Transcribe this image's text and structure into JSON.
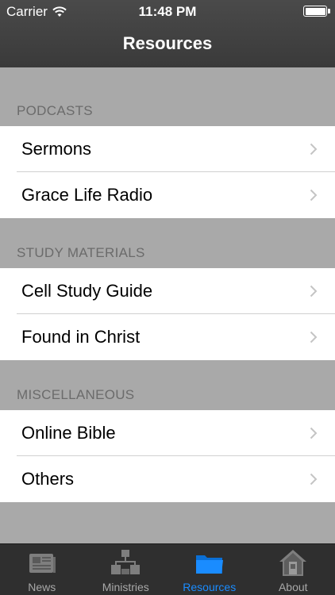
{
  "status_bar": {
    "carrier": "Carrier",
    "time": "11:48 PM"
  },
  "nav": {
    "title": "Resources"
  },
  "sections": [
    {
      "header": "PODCASTS",
      "items": [
        {
          "label": "Sermons"
        },
        {
          "label": "Grace Life Radio"
        }
      ]
    },
    {
      "header": "STUDY MATERIALS",
      "items": [
        {
          "label": "Cell Study Guide"
        },
        {
          "label": "Found in Christ"
        }
      ]
    },
    {
      "header": "MISCELLANEOUS",
      "items": [
        {
          "label": "Online Bible"
        },
        {
          "label": "Others"
        }
      ]
    }
  ],
  "tabbar": {
    "tabs": [
      {
        "label": "News",
        "icon": "newspaper-icon"
      },
      {
        "label": "Ministries",
        "icon": "org-chart-icon"
      },
      {
        "label": "Resources",
        "icon": "folder-icon",
        "active": true
      },
      {
        "label": "About",
        "icon": "house-icon"
      }
    ],
    "active_color": "#1a8cff"
  }
}
